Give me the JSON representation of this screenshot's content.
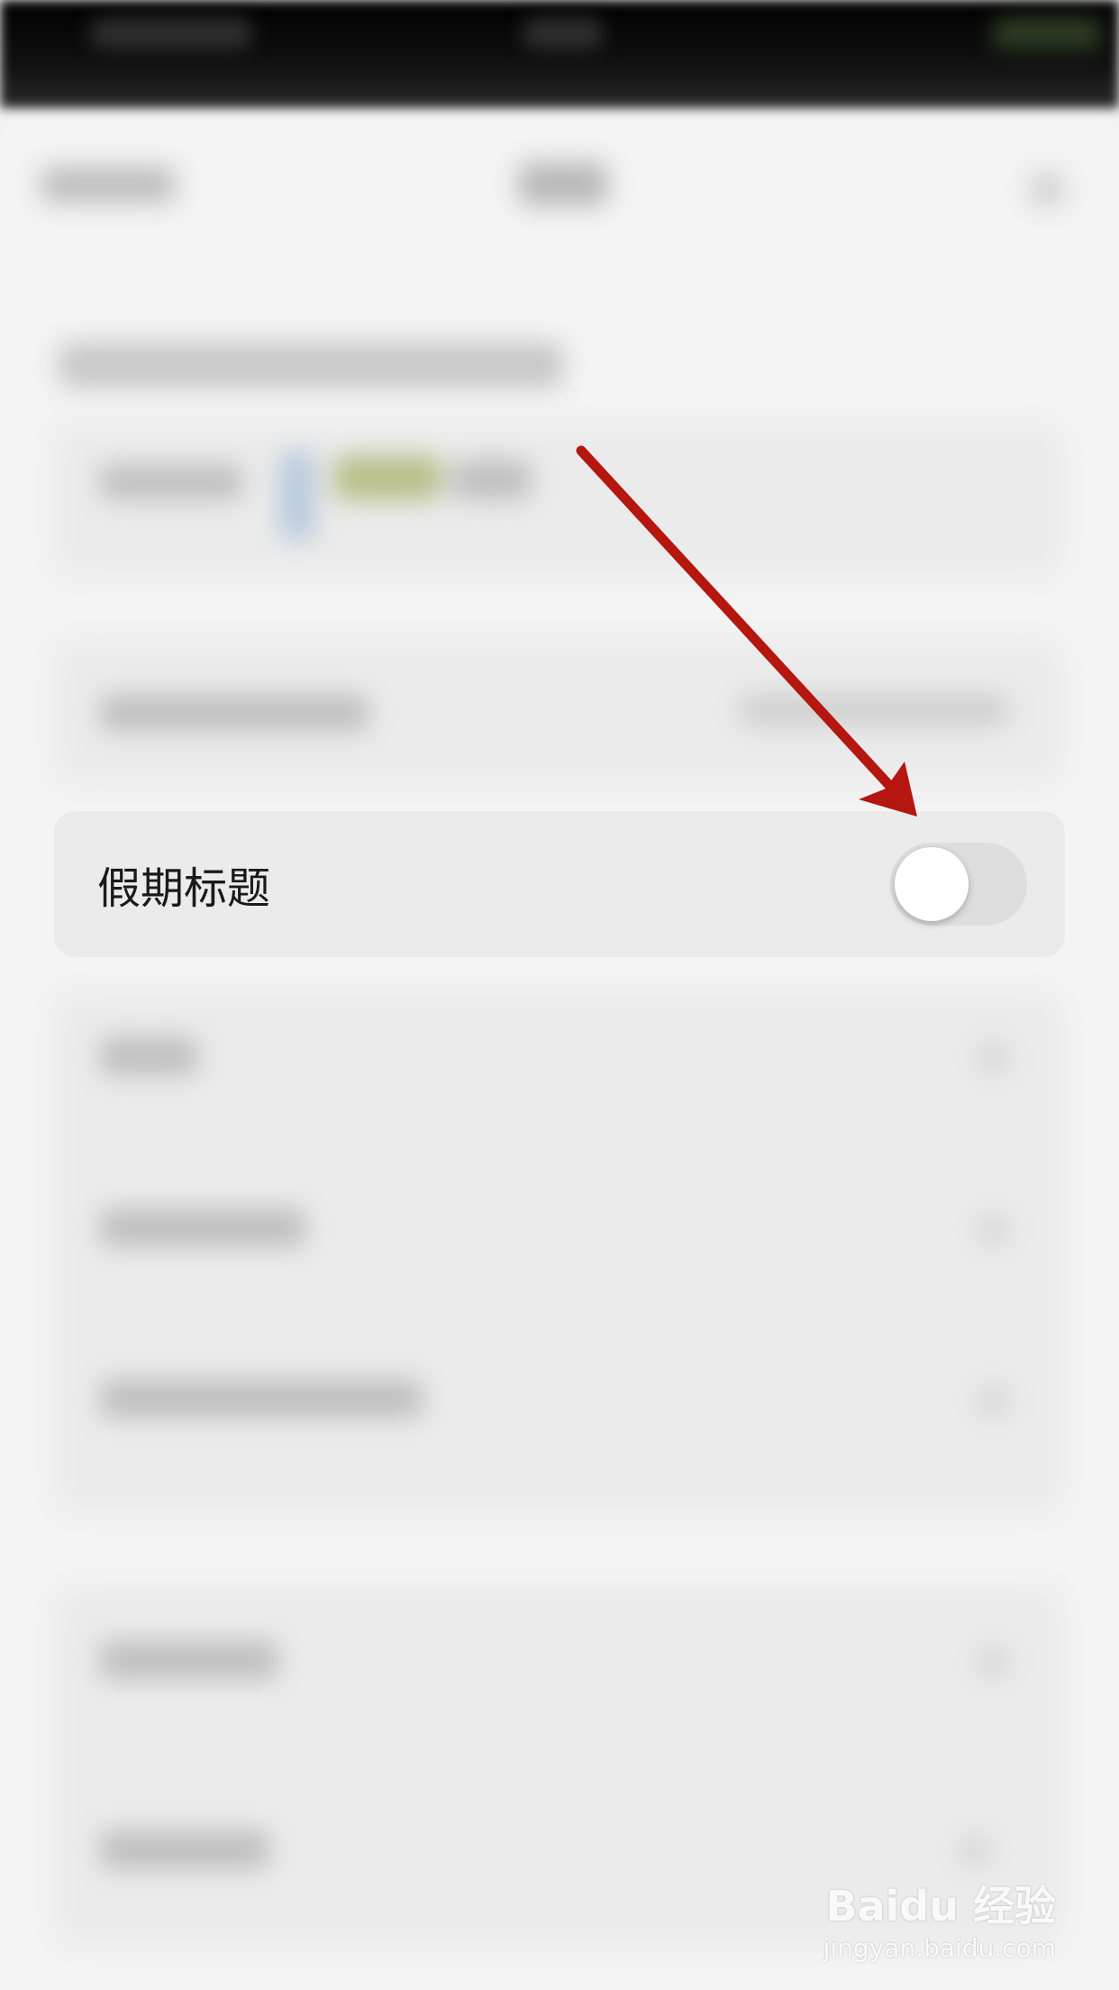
{
  "settings": {
    "holiday_title_label": "假期标题",
    "holiday_title_enabled": false
  },
  "annotation": {
    "arrow_color": "#b5160f"
  },
  "watermark": {
    "brand": "Baidu 经验",
    "url": "jingyan.baidu.com"
  },
  "colors": {
    "toggle_off_track": "#dedede",
    "row_background": "#ebebeb"
  }
}
